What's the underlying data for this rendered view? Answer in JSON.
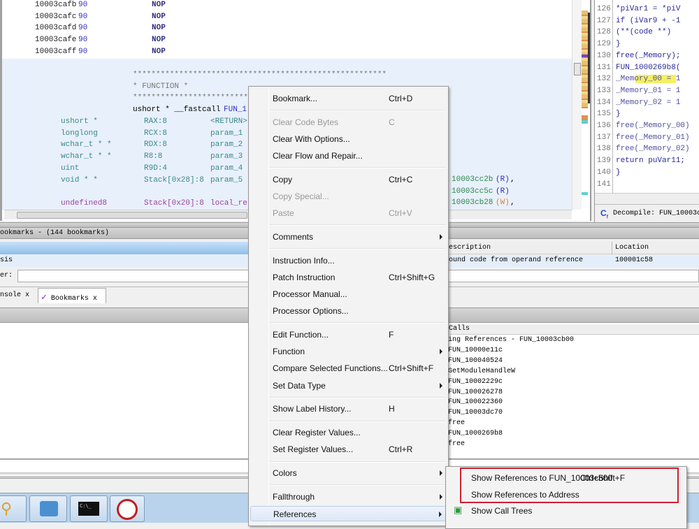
{
  "listing": {
    "nops": [
      [
        "10003cafb",
        "90",
        "NOP"
      ],
      [
        "10003cafc",
        "90",
        "NOP"
      ],
      [
        "10003cafd",
        "90",
        "NOP"
      ],
      [
        "10003cafe",
        "90",
        "NOP"
      ],
      [
        "10003caff",
        "90",
        "NOP"
      ]
    ],
    "stars": "*******************************************************",
    "func_banner": "*                    FUNCTION                         *",
    "stars2": "******************************",
    "signature_prefix": "ushort * __fastcall ",
    "signature_name": "FUN_1",
    "params": [
      [
        "ushort *",
        "RAX:8",
        "<RETURN>"
      ],
      [
        "longlong",
        "RCX:8",
        "param_1"
      ],
      [
        "wchar_t * *",
        "RDX:8",
        "param_2"
      ],
      [
        "wchar_t * *",
        "R8:8",
        "param_3"
      ],
      [
        "uint",
        "R9D:4",
        "param_4"
      ],
      [
        "void * *",
        "Stack[0x28]:8",
        "param_5"
      ]
    ],
    "local": [
      "undefined8",
      "Stack[0x20]:8",
      "local_re"
    ],
    "xrefs": [
      [
        "10003cc2b",
        "(R)",
        ","
      ],
      [
        "10003cc5c",
        "(R)",
        ""
      ],
      [
        "10003cb28",
        "(W)",
        ","
      ]
    ]
  },
  "decompile": {
    "lines": [
      [
        "126",
        "    *piVar1 = *piV"
      ],
      [
        "127",
        "    if (iVar9 + -1"
      ],
      [
        "128",
        "      (**(code **)"
      ],
      [
        "129",
        "    }"
      ],
      [
        "130",
        "    free(_Memory);"
      ],
      [
        "131",
        "    FUN_1000269b8("
      ],
      [
        "132",
        "    _Memory_00 = 1"
      ],
      [
        "133",
        "    _Memory_01 = 1"
      ],
      [
        "134",
        "    _Memory_02 = 1"
      ],
      [
        "135",
        "  }"
      ],
      [
        "136",
        "  free(_Memory_00)"
      ],
      [
        "137",
        "  free(_Memory_01)"
      ],
      [
        "138",
        "  free(_Memory_02)"
      ],
      [
        "139",
        "  return puVar11;"
      ],
      [
        "140",
        "}"
      ],
      [
        "141",
        ""
      ]
    ],
    "title": "Decompile: FUN_10003cb"
  },
  "bookmarks": {
    "title": "ookmarks - (144 bookmarks)",
    "col_description": "escription",
    "col_location": "Location",
    "row": {
      "type": "sis",
      "description": "ound code from operand reference",
      "location": "100001c58"
    },
    "filter_label": "er:",
    "filter_value": "",
    "tabs": [
      {
        "label": "nsole"
      },
      {
        "label": "Bookmarks"
      }
    ]
  },
  "calls": {
    "header": "Calls",
    "items": [
      "ing References - FUN_10003cb00",
      "FUN_10000e11c",
      "FUN_100040524",
      "GetModuleHandleW",
      "FUN_10002229c",
      "FUN_100026278",
      "FUN_100022360",
      "FUN_10003dc70",
      "free",
      "FUN_1000269b8",
      "free"
    ]
  },
  "context_menu": {
    "items": [
      {
        "label": "Bookmark...",
        "shortcut": "Ctrl+D"
      },
      {
        "sep": true
      },
      {
        "label": "Clear Code Bytes",
        "shortcut": "C",
        "disabled": true
      },
      {
        "label": "Clear With Options..."
      },
      {
        "label": "Clear Flow and Repair..."
      },
      {
        "sep": true
      },
      {
        "label": "Copy",
        "shortcut": "Ctrl+C"
      },
      {
        "label": "Copy Special...",
        "disabled": true
      },
      {
        "label": "Paste",
        "shortcut": "Ctrl+V",
        "disabled": true
      },
      {
        "sep": true
      },
      {
        "label": "Comments",
        "submenu": true
      },
      {
        "sep": true
      },
      {
        "label": "Instruction Info..."
      },
      {
        "label": "Patch Instruction",
        "shortcut": "Ctrl+Shift+G"
      },
      {
        "label": "Processor Manual..."
      },
      {
        "label": "Processor Options..."
      },
      {
        "sep": true
      },
      {
        "label": "Edit Function...",
        "shortcut": "F"
      },
      {
        "label": "Function",
        "submenu": true
      },
      {
        "label": "Compare Selected Functions...",
        "shortcut": "Ctrl+Shift+F"
      },
      {
        "label": "Set Data Type",
        "submenu": true
      },
      {
        "sep": true
      },
      {
        "label": "Show Label History...",
        "shortcut": "H"
      },
      {
        "sep": true
      },
      {
        "label": "Clear Register Values..."
      },
      {
        "label": "Set Register Values...",
        "shortcut": "Ctrl+R"
      },
      {
        "sep": true
      },
      {
        "label": "Colors",
        "submenu": true
      },
      {
        "sep": true
      },
      {
        "label": "Fallthrough",
        "submenu": true
      },
      {
        "label": "References",
        "submenu": true,
        "active": true
      }
    ]
  },
  "references_submenu": {
    "items": [
      {
        "label": "Show References to FUN_10003cb00",
        "shortcut": "Ctrl+Shift+F"
      },
      {
        "label": "Show References to Address"
      },
      {
        "label": "Show Call Trees",
        "icon": "call-tree-icon"
      }
    ],
    "highlight_color": "#d02030"
  },
  "taskbar": {
    "apps": [
      "search-file-icon",
      "control-panel-icon",
      "command-prompt-icon",
      "ghidra-icon"
    ]
  }
}
